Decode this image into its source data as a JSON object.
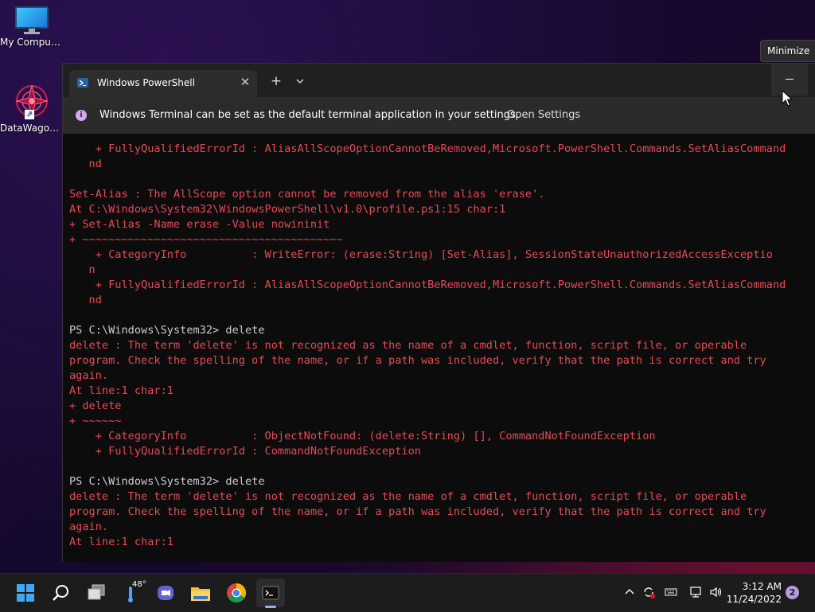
{
  "desktop": {
    "icons": [
      {
        "label": "My Computer"
      },
      {
        "label": "DataWagon..."
      }
    ]
  },
  "tooltip": {
    "text": "Minimize"
  },
  "window": {
    "tab_title": "Windows PowerShell",
    "tab_close": "✕",
    "new_tab": "+",
    "infobar": {
      "message": "Windows Terminal can be set as the default terminal application in your settings.",
      "link": "Open Settings"
    }
  },
  "console": {
    "lines": [
      {
        "text": "    + FullyQualifiedErrorId : AliasAllScopeOptionCannotBeRemoved,Microsoft.PowerShell.Commands.SetAliasCommand",
        "kind": "err"
      },
      {
        "text": "   nd",
        "kind": "err"
      },
      {
        "text": "",
        "kind": "out"
      },
      {
        "text": "Set-Alias : The AllScope option cannot be removed from the alias 'erase'.",
        "kind": "err"
      },
      {
        "text": "At C:\\Windows\\System32\\WindowsPowerShell\\v1.0\\profile.ps1:15 char:1",
        "kind": "err"
      },
      {
        "text": "+ Set-Alias -Name erase -Value nowininit",
        "kind": "err"
      },
      {
        "text": "+ ~~~~~~~~~~~~~~~~~~~~~~~~~~~~~~~~~~~~~~~~",
        "kind": "err"
      },
      {
        "text": "    + CategoryInfo          : WriteError: (erase:String) [Set-Alias], SessionStateUnauthorizedAccessExceptio",
        "kind": "err"
      },
      {
        "text": "   n",
        "kind": "err"
      },
      {
        "text": "    + FullyQualifiedErrorId : AliasAllScopeOptionCannotBeRemoved,Microsoft.PowerShell.Commands.SetAliasCommand",
        "kind": "err"
      },
      {
        "text": "   nd",
        "kind": "err"
      },
      {
        "text": "",
        "kind": "out"
      },
      {
        "text": "PS C:\\Windows\\System32> delete",
        "kind": "out"
      },
      {
        "text": "delete : The term 'delete' is not recognized as the name of a cmdlet, function, script file, or operable",
        "kind": "err"
      },
      {
        "text": "program. Check the spelling of the name, or if a path was included, verify that the path is correct and try",
        "kind": "err"
      },
      {
        "text": "again.",
        "kind": "err"
      },
      {
        "text": "At line:1 char:1",
        "kind": "err"
      },
      {
        "text": "+ delete",
        "kind": "err"
      },
      {
        "text": "+ ~~~~~~",
        "kind": "err"
      },
      {
        "text": "    + CategoryInfo          : ObjectNotFound: (delete:String) [], CommandNotFoundException",
        "kind": "err"
      },
      {
        "text": "    + FullyQualifiedErrorId : CommandNotFoundException",
        "kind": "err"
      },
      {
        "text": "",
        "kind": "out"
      },
      {
        "text": "PS C:\\Windows\\System32> delete",
        "kind": "out"
      },
      {
        "text": "delete : The term 'delete' is not recognized as the name of a cmdlet, function, script file, or operable",
        "kind": "err"
      },
      {
        "text": "program. Check the spelling of the name, or if a path was included, verify that the path is correct and try",
        "kind": "err"
      },
      {
        "text": "again.",
        "kind": "err"
      },
      {
        "text": "At line:1 char:1",
        "kind": "err"
      }
    ]
  },
  "taskbar": {
    "weather_temp": "48°",
    "clock_time": "3:12 AM",
    "clock_date": "11/24/2022",
    "notification_count": "2"
  },
  "colors": {
    "error_text": "#e74856",
    "console_text": "#cccccc",
    "console_bg": "#0c0c0c"
  }
}
